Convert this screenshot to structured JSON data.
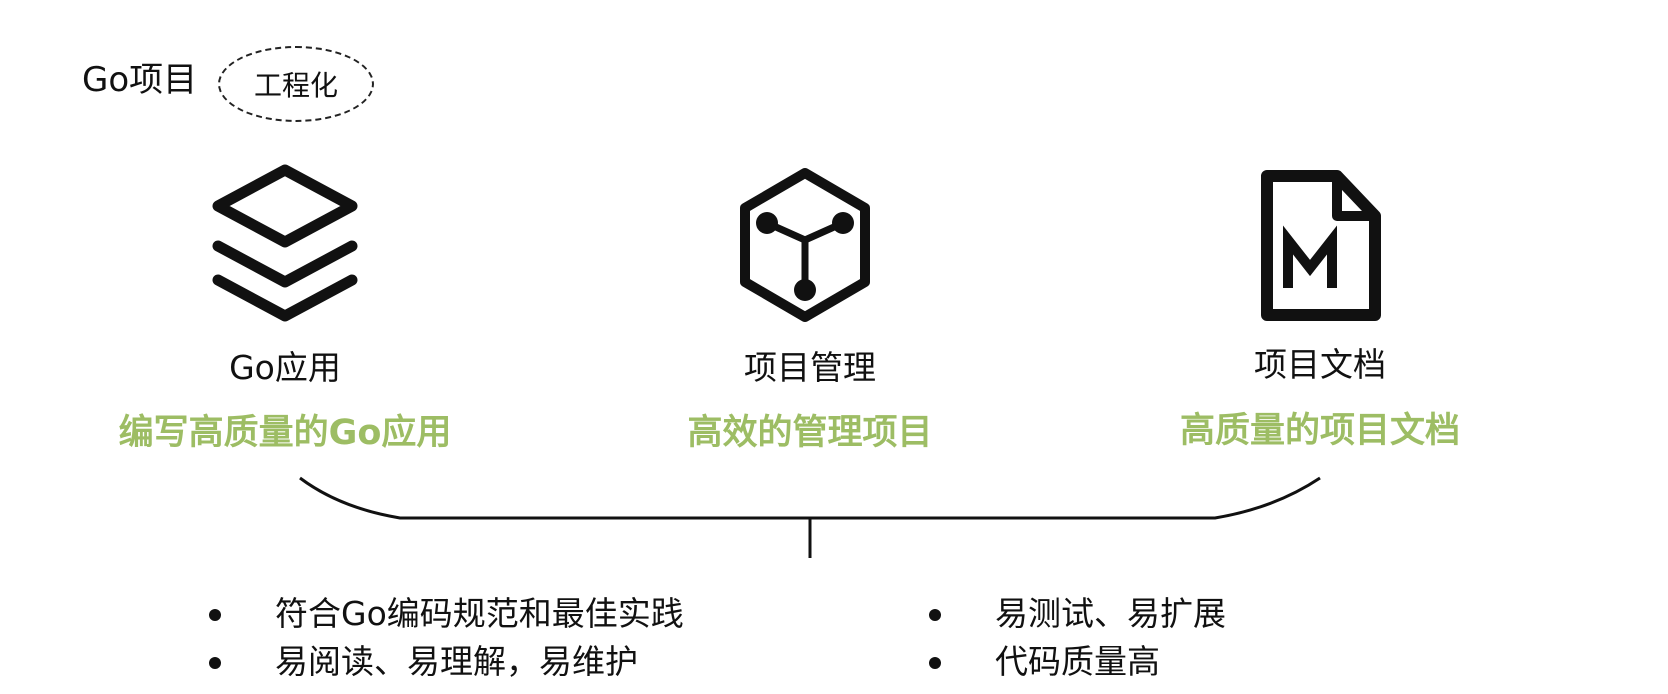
{
  "header": {
    "title": "Go项目",
    "badge": "工程化"
  },
  "columns": [
    {
      "icon": "layers-icon",
      "name": "Go应用",
      "desc": "编写高质量的Go应用"
    },
    {
      "icon": "cube-network-icon",
      "name": "项目管理",
      "desc": "高效的管理项目"
    },
    {
      "icon": "markdown-file-icon",
      "name": "项目文档",
      "desc": "高质量的项目文档"
    }
  ],
  "bullets_left": [
    "符合Go编码规范和最佳实践",
    "易阅读、易理解，易维护"
  ],
  "bullets_right": [
    "易测试、易扩展",
    "代码质量高"
  ],
  "colors": {
    "accent": "#9dbd64",
    "ink": "#111111"
  }
}
